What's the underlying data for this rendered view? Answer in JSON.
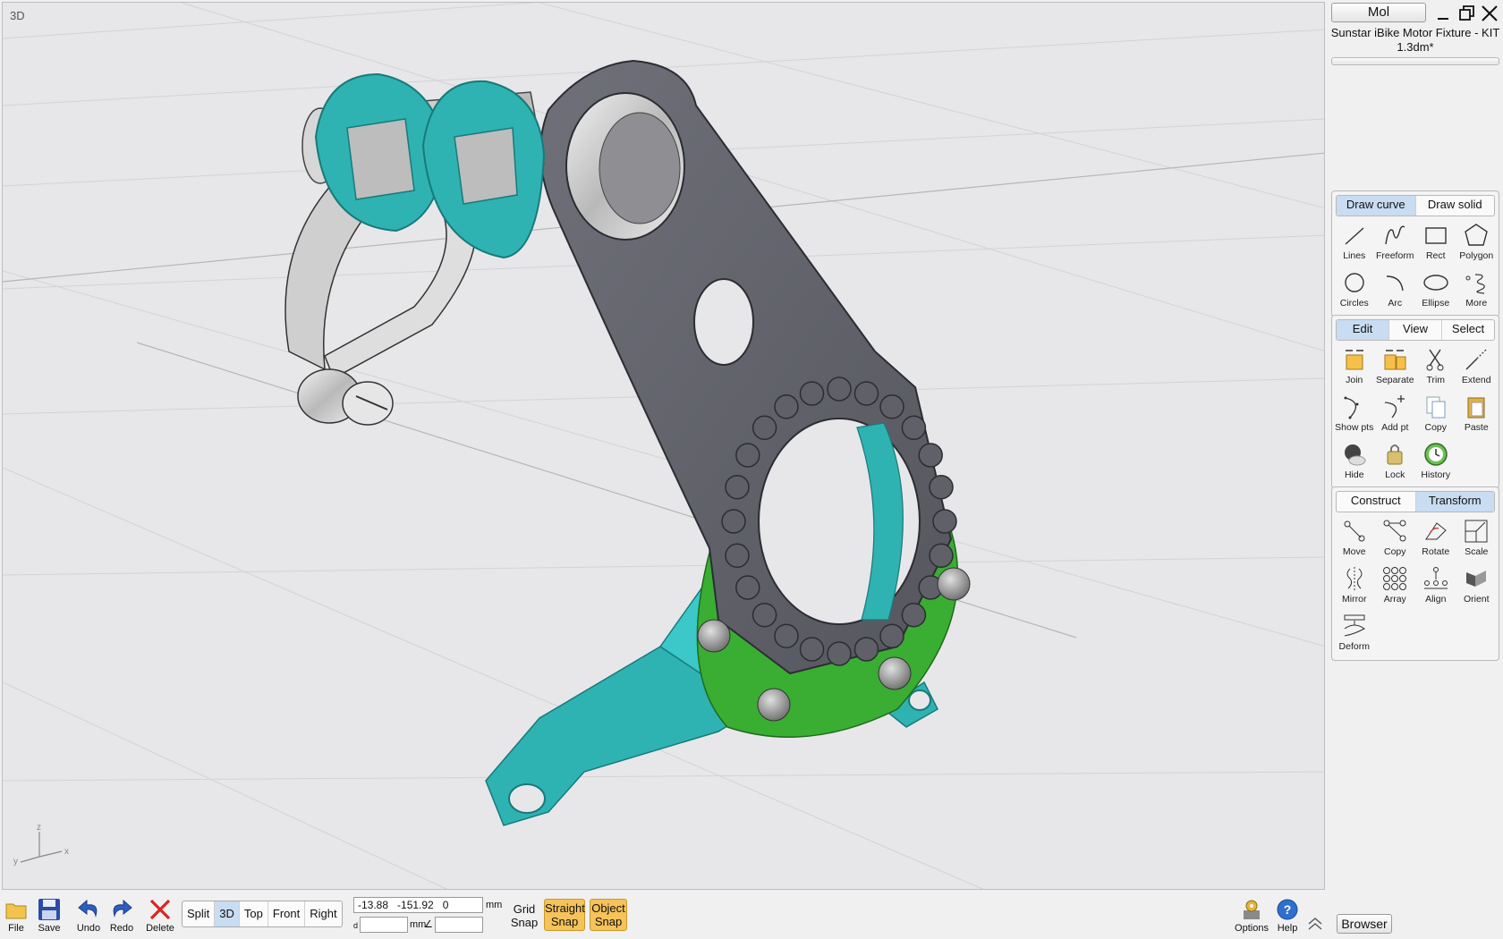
{
  "viewport": {
    "label": "3D",
    "axes": {
      "z": "z",
      "y": "y",
      "x": "x"
    }
  },
  "panel": {
    "mol_label": "Mol",
    "document_title": "Sunstar iBike Motor Fixture - KIT 1.3dm*",
    "draw": {
      "tabs": [
        {
          "label": "Draw curve",
          "active": true
        },
        {
          "label": "Draw solid",
          "active": false
        }
      ],
      "tools": [
        {
          "label": "Lines",
          "icon": "line-icon"
        },
        {
          "label": "Freeform",
          "icon": "freeform-icon"
        },
        {
          "label": "Rect",
          "icon": "rect-icon"
        },
        {
          "label": "Polygon",
          "icon": "polygon-icon"
        },
        {
          "label": "Circles",
          "icon": "circle-icon"
        },
        {
          "label": "Arc",
          "icon": "arc-icon"
        },
        {
          "label": "Ellipse",
          "icon": "ellipse-icon"
        },
        {
          "label": "More",
          "icon": "more-icon"
        }
      ]
    },
    "edit": {
      "tabs": [
        {
          "label": "Edit",
          "active": true
        },
        {
          "label": "View",
          "active": false
        },
        {
          "label": "Select",
          "active": false
        }
      ],
      "tools": [
        {
          "label": "Join",
          "icon": "join-icon"
        },
        {
          "label": "Separate",
          "icon": "separate-icon"
        },
        {
          "label": "Trim",
          "icon": "trim-icon"
        },
        {
          "label": "Extend",
          "icon": "extend-icon"
        },
        {
          "label": "Show pts",
          "icon": "show-points-icon"
        },
        {
          "label": "Add pt",
          "icon": "add-point-icon"
        },
        {
          "label": "Copy",
          "icon": "copy-icon"
        },
        {
          "label": "Paste",
          "icon": "paste-icon"
        },
        {
          "label": "Hide",
          "icon": "hide-icon"
        },
        {
          "label": "Lock",
          "icon": "lock-icon"
        },
        {
          "label": "History",
          "icon": "history-icon"
        }
      ]
    },
    "transform": {
      "tabs": [
        {
          "label": "Construct",
          "active": false
        },
        {
          "label": "Transform",
          "active": true
        }
      ],
      "tools": [
        {
          "label": "Move",
          "icon": "move-icon"
        },
        {
          "label": "Copy",
          "icon": "copy-transform-icon"
        },
        {
          "label": "Rotate",
          "icon": "rotate-icon"
        },
        {
          "label": "Scale",
          "icon": "scale-icon"
        },
        {
          "label": "Mirror",
          "icon": "mirror-icon"
        },
        {
          "label": "Array",
          "icon": "array-icon"
        },
        {
          "label": "Align",
          "icon": "align-icon"
        },
        {
          "label": "Orient",
          "icon": "orient-icon"
        },
        {
          "label": "Deform",
          "icon": "deform-icon"
        }
      ]
    }
  },
  "bottombar": {
    "file": "File",
    "save": "Save",
    "undo": "Undo",
    "redo": "Redo",
    "delete": "Delete",
    "views": [
      {
        "label": "Split",
        "active": false
      },
      {
        "label": "3D",
        "active": true
      },
      {
        "label": "Top",
        "active": false
      },
      {
        "label": "Front",
        "active": false
      },
      {
        "label": "Right",
        "active": false
      }
    ],
    "coords": "-13.88   -151.92   0",
    "unit_mm": "mm",
    "distance_prefix": "d",
    "distance_unit": "mm",
    "angle_symbol": "∠",
    "grid_snap": "Grid Snap",
    "straight_snap": "Straight Snap",
    "object_snap": "Object Snap",
    "options": "Options",
    "help": "Help",
    "browser": "Browser"
  },
  "colors": {
    "plate": "#5f6068",
    "teal": "#2fb2b2",
    "green": "#3aad33",
    "metal": "#c8c8c8",
    "active_tab": "#c8dcf2",
    "snap_active": "#f6c25a"
  }
}
